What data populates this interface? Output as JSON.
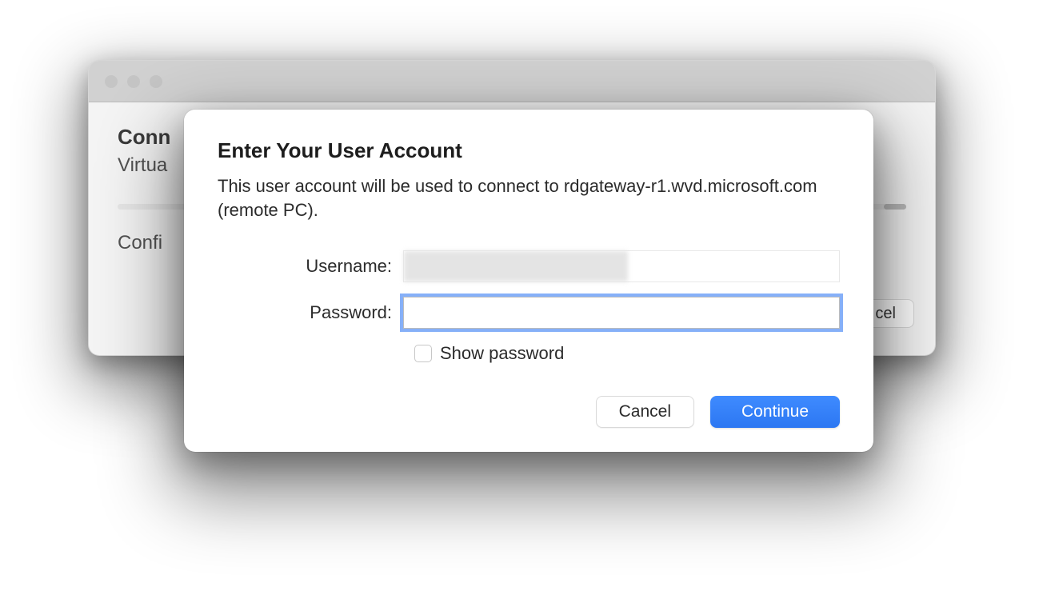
{
  "background_window": {
    "title_fragment": "Conn",
    "subtitle_fragment": "Virtua",
    "status_fragment": "Confi",
    "cancel_fragment": "cel"
  },
  "dialog": {
    "title": "Enter Your User Account",
    "description": "This user account will be used to connect to rdgateway-r1.wvd.microsoft.com (remote PC).",
    "username_label": "Username:",
    "username_value": "",
    "password_label": "Password:",
    "password_value": "",
    "show_password_label": "Show password",
    "cancel_label": "Cancel",
    "continue_label": "Continue"
  }
}
